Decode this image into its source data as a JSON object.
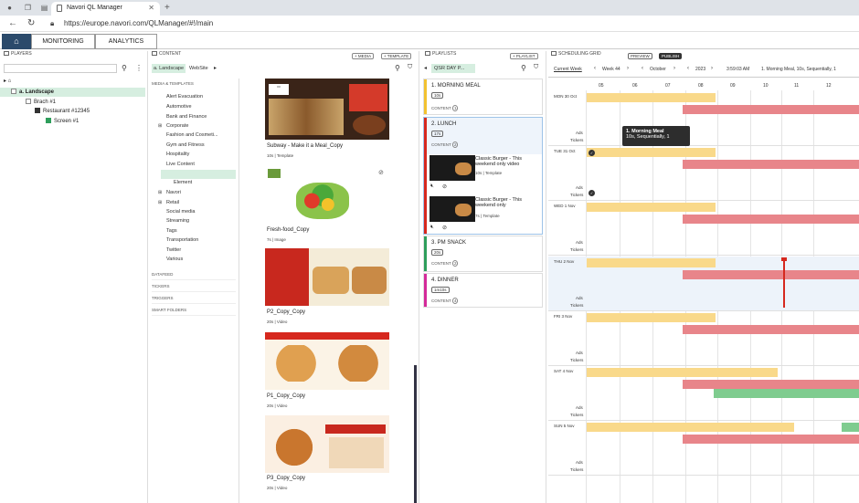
{
  "browser": {
    "tab_title": "Navori QL Manager",
    "url": "https://europe.navori.com/QLManager/#!/main"
  },
  "nav": {
    "monitoring": "MONITORING",
    "analytics": "ANALYTICS"
  },
  "players": {
    "title": "PLAYERS",
    "tree": [
      {
        "label": "a. Landscape"
      },
      {
        "label": "Brach #1"
      },
      {
        "label": "Restaurant #12345"
      },
      {
        "label": "Screen #1"
      }
    ]
  },
  "content": {
    "title": "CONTENT",
    "media_btn": "+ MEDIA",
    "template_btn": "+ TEMPLATE",
    "filter_tag": "a. Landscape",
    "filter_site": "WebSite",
    "section_media": "MEDIA & TEMPLATES",
    "categories": [
      "Alert Evacuation",
      "Automotive",
      "Bank and Finance",
      "Corporate",
      "Fashion and Cosmeti...",
      "Gym and Fitness",
      "Hospitality",
      "Live Content",
      "Menu Board",
      "Element",
      "Navori",
      "Retail",
      "Social media",
      "Streaming",
      "Tags",
      "Transportation",
      "Twitter",
      "Various"
    ],
    "sections": [
      "DATAFEED",
      "TICKERS",
      "TRIGGERS",
      "SMART FOLDERS"
    ],
    "items": [
      {
        "name": "Subway - Make it a Meal_Copy",
        "meta": "10s | Template"
      },
      {
        "name": "Fresh-food_Copy",
        "meta": "7s | Image"
      },
      {
        "name": "P2_Copy_Copy",
        "meta": "20s | Video"
      },
      {
        "name": "P1_Copy_Copy",
        "meta": "20s | Video"
      },
      {
        "name": "P3_Copy_Copy",
        "meta": "20s | Video"
      }
    ]
  },
  "playlists": {
    "title": "PLAYLISTS",
    "add_btn": "+ PLAYLIST",
    "filter": "QSR DAY P...",
    "items": [
      {
        "name": "1. MORNING MEAL",
        "dur": "10s",
        "content": "CONTENT",
        "count": "1"
      },
      {
        "name": "2. LUNCH",
        "dur": "17s",
        "content": "CONTENT",
        "count": "2"
      },
      {
        "name": "3. PM SNACK",
        "dur": "20s",
        "content": "CONTENT",
        "count": "2"
      },
      {
        "name": "4. DINNER",
        "dur": "1m10s",
        "content": "CONTENT",
        "count": "4"
      }
    ],
    "lunch_items": [
      {
        "name": "Classic Burger - This weekend only video",
        "meta": "10s | Template"
      },
      {
        "name": "Classic Burger - This weekend only",
        "meta": "7s | Template"
      }
    ]
  },
  "grid": {
    "title": "SCHEDULING GRID",
    "preview": "PREVIEW",
    "publish": "PUBLISH",
    "current_week": "Current Week",
    "week": "Week 44",
    "month": "October",
    "year": "2023",
    "time": "3:59:03 AM",
    "info": "1. Morning Meal, 10s, Sequentially, 1",
    "hours": [
      "05",
      "06",
      "07",
      "08",
      "09",
      "10",
      "11",
      "12"
    ],
    "days": [
      "MON 30 Oct",
      "TUE 31 Oct",
      "WED 1 Nov",
      "THU 2 Nov",
      "FRI 3 Nov",
      "SAT 4 Nov",
      "SUN 5 Nov"
    ],
    "ads": "Ads",
    "tickers": "Tickers",
    "tooltip_line1": "1. Morning Meal",
    "tooltip_line2": "10s, Sequentially, 1"
  },
  "colors": {
    "accent": "#2e9e5b",
    "yellow": "#f9d98a",
    "red": "#e8858a",
    "green": "#7fcc8f"
  }
}
